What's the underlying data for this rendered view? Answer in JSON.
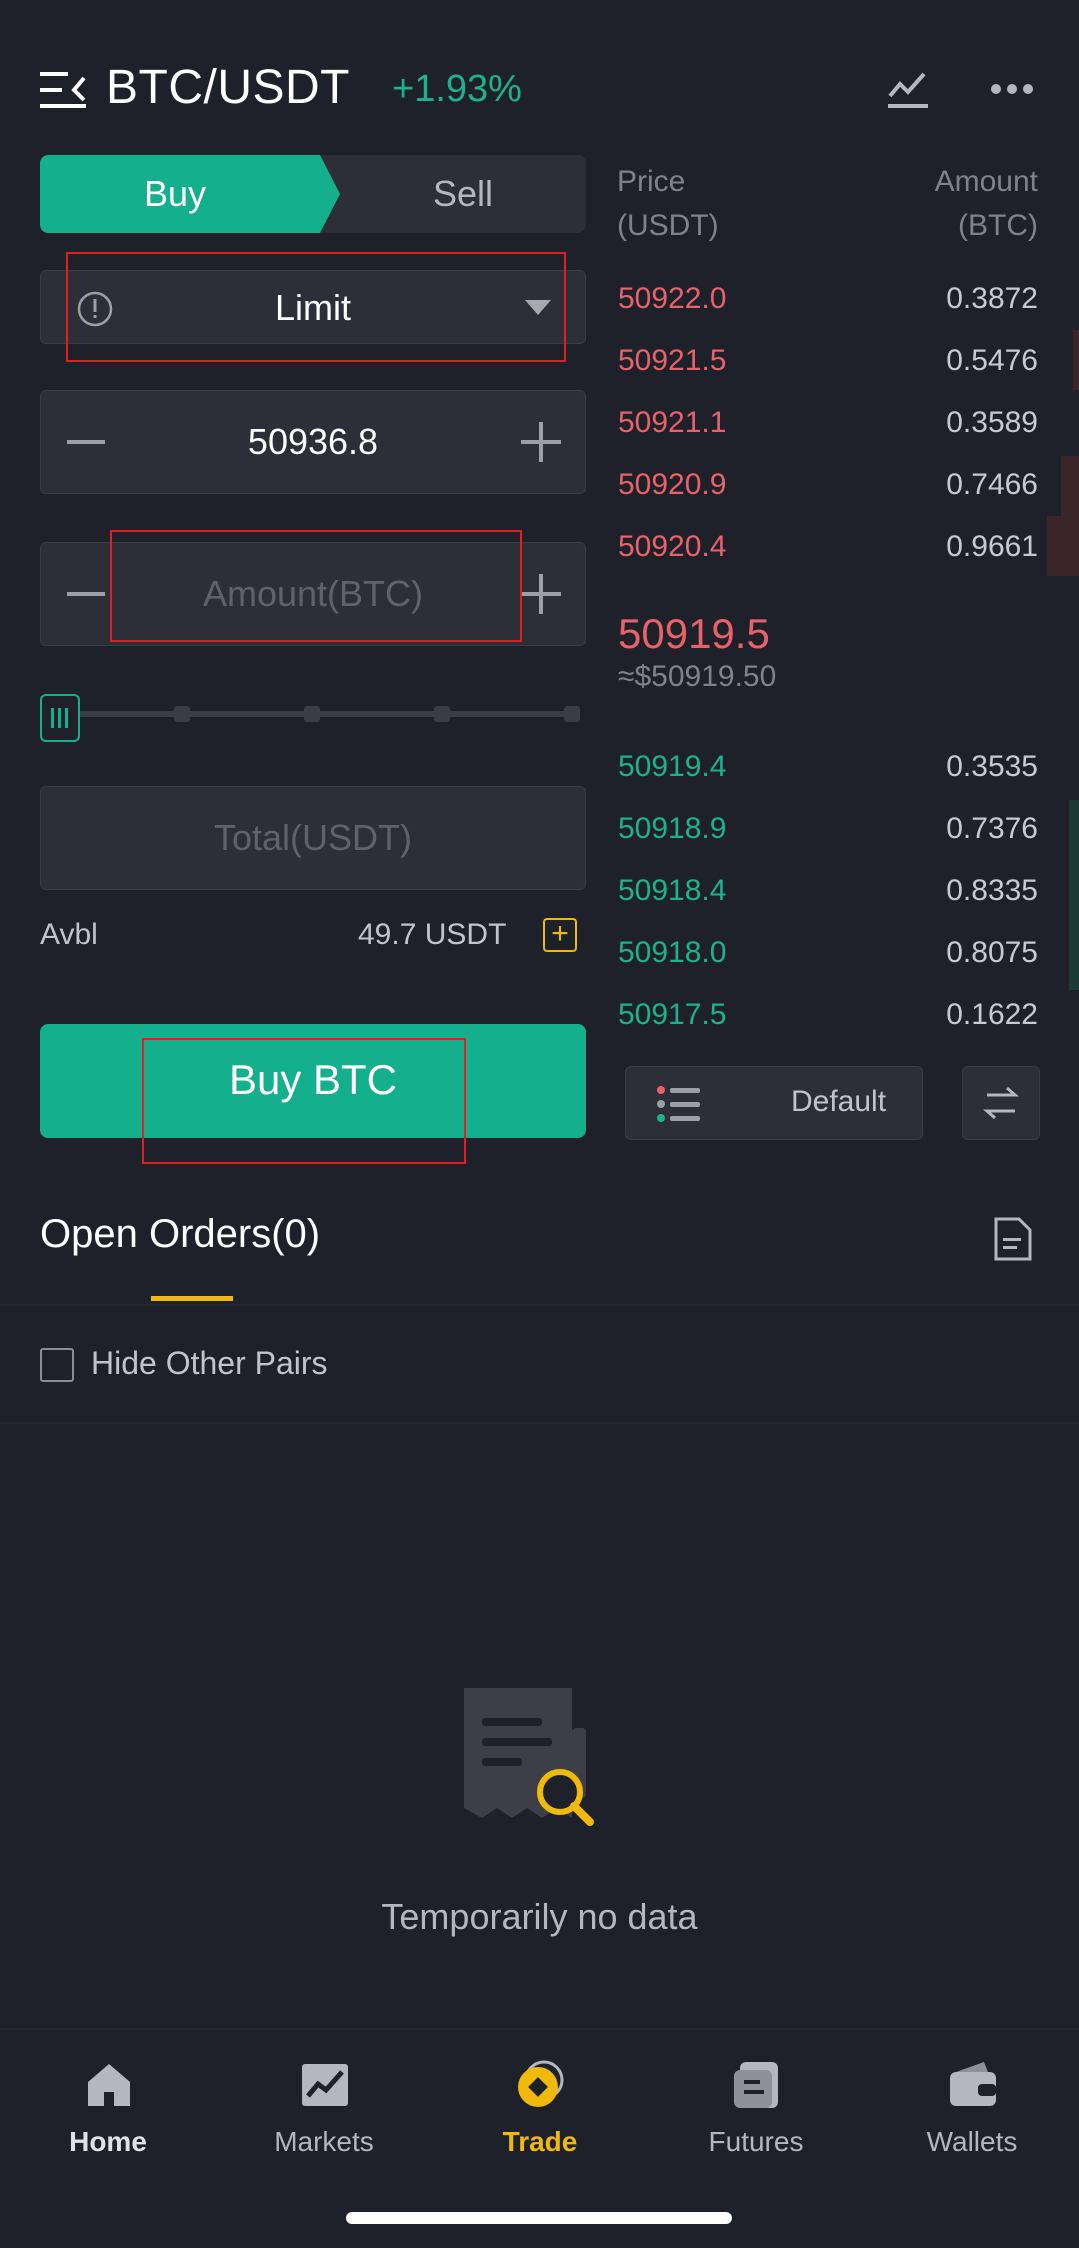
{
  "header": {
    "pair": "BTC/USDT",
    "change": "+1.93%",
    "icons": [
      "menu-icon",
      "chart-icon",
      "more-icon"
    ]
  },
  "trade_tabs": {
    "buy": "Buy",
    "sell": "Sell"
  },
  "order_form": {
    "order_type": "Limit",
    "price_value": "50936.8",
    "amount_placeholder": "Amount(BTC)",
    "total_placeholder": "Total(USDT)",
    "slider_percent": 0,
    "avbl_label": "Avbl",
    "avbl_value": "49.7 USDT",
    "submit_label": "Buy BTC"
  },
  "order_book": {
    "price_header": "Price\n(USDT)",
    "price_header_l1": "Price",
    "price_header_l2": "(USDT)",
    "amount_header_l1": "Amount",
    "amount_header_l2": "(BTC)",
    "asks": [
      {
        "price": "50922.0",
        "amount": "0.3872"
      },
      {
        "price": "50921.5",
        "amount": "0.5476"
      },
      {
        "price": "50921.1",
        "amount": "0.3589"
      },
      {
        "price": "50920.9",
        "amount": "0.7466"
      },
      {
        "price": "50920.4",
        "amount": "0.9661"
      }
    ],
    "last_price": "50919.5",
    "last_price_usd": "≈$50919.50",
    "bids": [
      {
        "price": "50919.4",
        "amount": "0.3535"
      },
      {
        "price": "50918.9",
        "amount": "0.7376"
      },
      {
        "price": "50918.4",
        "amount": "0.8335"
      },
      {
        "price": "50918.0",
        "amount": "0.8075"
      },
      {
        "price": "50917.5",
        "amount": "0.1622"
      }
    ],
    "view_mode": "Default"
  },
  "open_orders": {
    "title": "Open Orders(0)",
    "hide_other_pairs": "Hide Other Pairs",
    "empty_text": "Temporarily no data"
  },
  "bottom_nav": [
    {
      "label": "Home",
      "icon": "home-icon"
    },
    {
      "label": "Markets",
      "icon": "markets-icon"
    },
    {
      "label": "Trade",
      "icon": "trade-icon",
      "active": true
    },
    {
      "label": "Futures",
      "icon": "futures-icon"
    },
    {
      "label": "Wallets",
      "icon": "wallet-icon"
    }
  ],
  "colors": {
    "background": "#1e2129",
    "accent_green": "#14b08e",
    "ask_red": "#e8626a",
    "highlight_yellow": "#f0b90b"
  }
}
